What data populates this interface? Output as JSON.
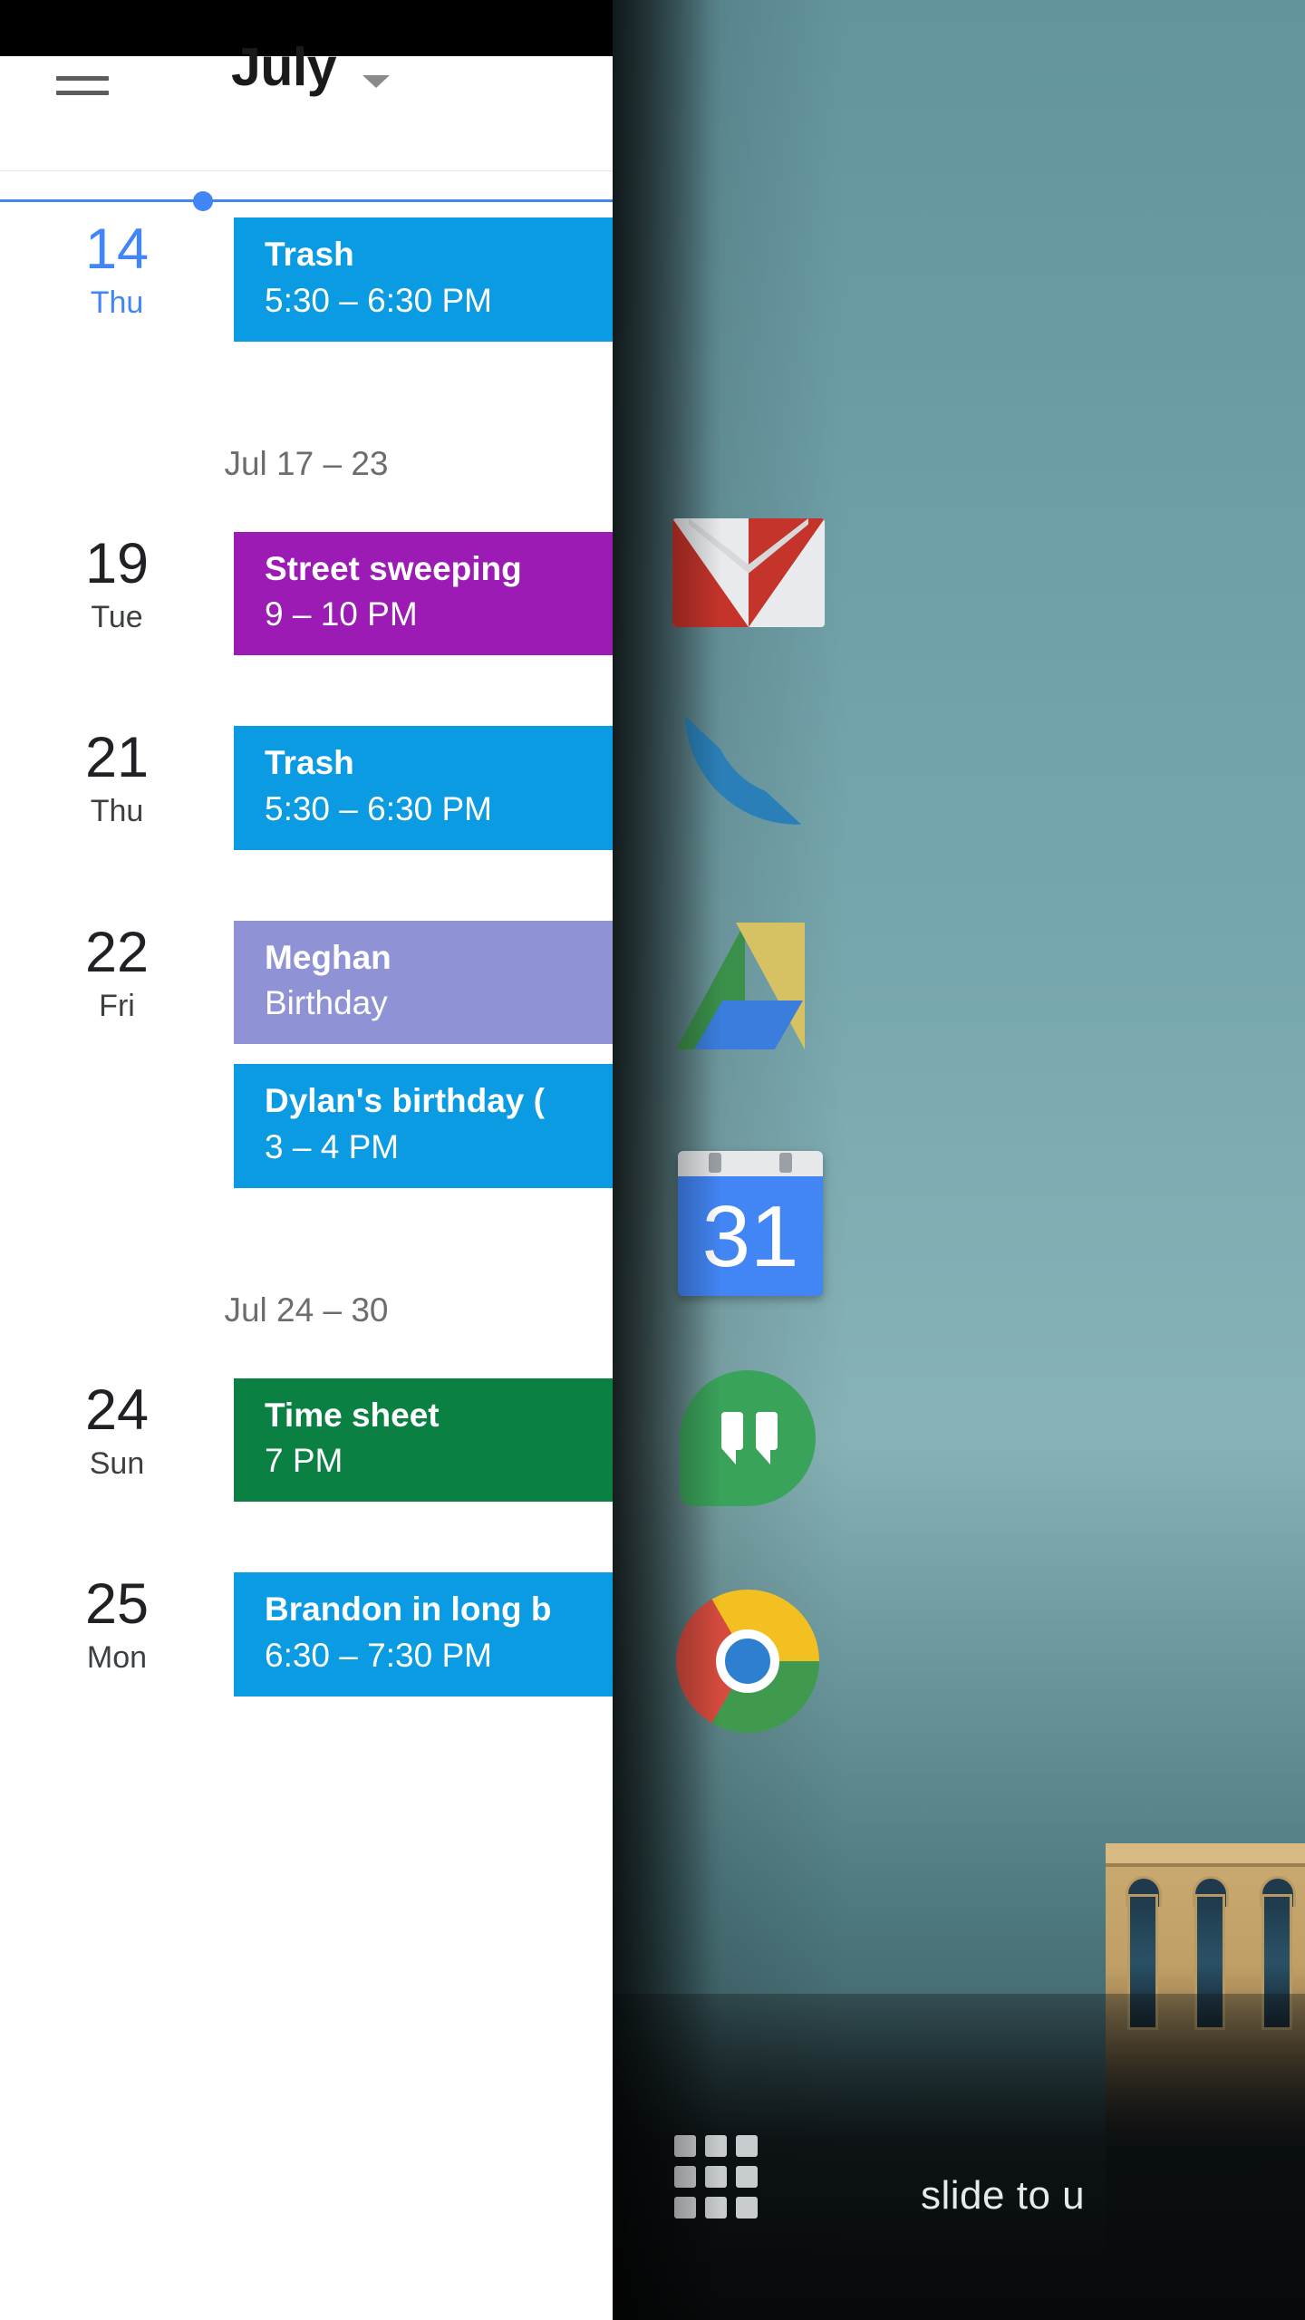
{
  "app": {
    "title": "July",
    "menu_icon": "hamburger-menu-icon",
    "caret_icon": "chevron-down-icon"
  },
  "agenda": [
    {
      "type": "day",
      "daynum": "14",
      "dayname": "Thu",
      "today": true,
      "events": [
        {
          "title": "Trash",
          "time": "5:30 – 6:30 PM",
          "color": "#0b9be3"
        }
      ]
    },
    {
      "type": "week_label",
      "label": "Jul 17 – 23"
    },
    {
      "type": "day",
      "daynum": "19",
      "dayname": "Tue",
      "today": false,
      "events": [
        {
          "title": "Street sweeping",
          "time": "9 – 10 PM",
          "color": "#9c1bb5"
        }
      ]
    },
    {
      "type": "day",
      "daynum": "21",
      "dayname": "Thu",
      "today": false,
      "events": [
        {
          "title": "Trash",
          "time": "5:30 – 6:30 PM",
          "color": "#0b9be3"
        }
      ]
    },
    {
      "type": "day",
      "daynum": "22",
      "dayname": "Fri",
      "today": false,
      "events": [
        {
          "title": "Meghan",
          "time": "Birthday",
          "color": "#8f92d4"
        },
        {
          "title": "Dylan's birthday (",
          "time": "3 – 4 PM",
          "color": "#0b9be3"
        }
      ]
    },
    {
      "type": "week_label",
      "label": "Jul 24 – 30"
    },
    {
      "type": "day",
      "daynum": "24",
      "dayname": "Sun",
      "today": false,
      "events": [
        {
          "title": "Time sheet",
          "time": "7 PM",
          "color": "#0b8043"
        }
      ]
    },
    {
      "type": "day",
      "daynum": "25",
      "dayname": "Mon",
      "today": false,
      "events": [
        {
          "title": "Brandon in long b",
          "time": "6:30 – 7:30 PM",
          "color": "#0b9be3"
        }
      ]
    }
  ],
  "home": {
    "icons": [
      {
        "name": "gmail",
        "label": "Gmail"
      },
      {
        "name": "phone",
        "label": "Phone"
      },
      {
        "name": "drive",
        "label": "Drive"
      },
      {
        "name": "calendar",
        "label": "Calendar",
        "badge": "31"
      },
      {
        "name": "hangouts",
        "label": "Hangouts"
      },
      {
        "name": "chrome",
        "label": "Chrome"
      }
    ],
    "drawer_icon": "apps-grid-icon",
    "slide_hint": "slide to u"
  },
  "colors": {
    "accent": "#4285f4",
    "event_blue": "#0b9be3",
    "event_purple": "#9c1bb5",
    "event_lavender": "#8f92d4",
    "event_green": "#0b8043"
  }
}
